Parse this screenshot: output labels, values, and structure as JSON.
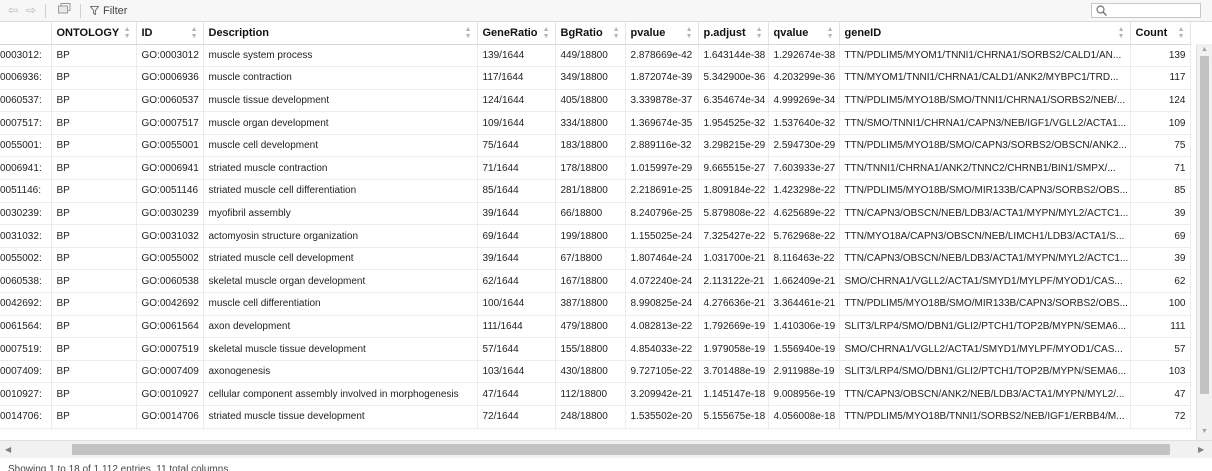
{
  "toolbar": {
    "filter_label": "Filter",
    "search_placeholder": ""
  },
  "columns": [
    "",
    "ONTOLOGY",
    "ID",
    "Description",
    "GeneRatio",
    "BgRatio",
    "pvalue",
    "p.adjust",
    "qvalue",
    "geneID",
    "Count"
  ],
  "rows": [
    [
      ":0003012",
      "BP",
      "GO:0003012",
      "muscle system process",
      "139/1644",
      "449/18800",
      "2.878669e-42",
      "1.643144e-38",
      "1.292674e-38",
      "TTN/PDLIM5/MYOM1/TNNI1/CHRNA1/SORBS2/CALD1/AN...",
      "139"
    ],
    [
      ":0006936",
      "BP",
      "GO:0006936",
      "muscle contraction",
      "117/1644",
      "349/18800",
      "1.872074e-39",
      "5.342900e-36",
      "4.203299e-36",
      "TTN/MYOM1/TNNI1/CHRNA1/CALD1/ANK2/MYBPC1/TRD...",
      "117"
    ],
    [
      ":0060537",
      "BP",
      "GO:0060537",
      "muscle tissue development",
      "124/1644",
      "405/18800",
      "3.339878e-37",
      "6.354674e-34",
      "4.999269e-34",
      "TTN/PDLIM5/MYO18B/SMO/TNNI1/CHRNA1/SORBS2/NEB/...",
      "124"
    ],
    [
      ":0007517",
      "BP",
      "GO:0007517",
      "muscle organ development",
      "109/1644",
      "334/18800",
      "1.369674e-35",
      "1.954525e-32",
      "1.537640e-32",
      "TTN/SMO/TNNI1/CHRNA1/CAPN3/NEB/IGF1/VGLL2/ACTA1...",
      "109"
    ],
    [
      ":0055001",
      "BP",
      "GO:0055001",
      "muscle cell development",
      "75/1644",
      "183/18800",
      "2.889116e-32",
      "3.298215e-29",
      "2.594730e-29",
      "TTN/PDLIM5/MYO18B/SMO/CAPN3/SORBS2/OBSCN/ANK2...",
      "75"
    ],
    [
      ":0006941",
      "BP",
      "GO:0006941",
      "striated muscle contraction",
      "71/1644",
      "178/18800",
      "1.015997e-29",
      "9.665515e-27",
      "7.603933e-27",
      "TTN/TNNI1/CHRNA1/ANK2/TNNC2/CHRNB1/BIN1/SMPX/...",
      "71"
    ],
    [
      ":0051146",
      "BP",
      "GO:0051146",
      "striated muscle cell differentiation",
      "85/1644",
      "281/18800",
      "2.218691e-25",
      "1.809184e-22",
      "1.423298e-22",
      "TTN/PDLIM5/MYO18B/SMO/MIR133B/CAPN3/SORBS2/OBS...",
      "85"
    ],
    [
      ":0030239",
      "BP",
      "GO:0030239",
      "myofibril assembly",
      "39/1644",
      "66/18800",
      "8.240796e-25",
      "5.879808e-22",
      "4.625689e-22",
      "TTN/CAPN3/OBSCN/NEB/LDB3/ACTA1/MYPN/MYL2/ACTC1...",
      "39"
    ],
    [
      ":0031032",
      "BP",
      "GO:0031032",
      "actomyosin structure organization",
      "69/1644",
      "199/18800",
      "1.155025e-24",
      "7.325427e-22",
      "5.762968e-22",
      "TTN/MYO18A/CAPN3/OBSCN/NEB/LIMCH1/LDB3/ACTA1/S...",
      "69"
    ],
    [
      ":0055002",
      "BP",
      "GO:0055002",
      "striated muscle cell development",
      "39/1644",
      "67/18800",
      "1.807464e-24",
      "1.031700e-21",
      "8.116463e-22",
      "TTN/CAPN3/OBSCN/NEB/LDB3/ACTA1/MYPN/MYL2/ACTC1...",
      "39"
    ],
    [
      ":0060538",
      "BP",
      "GO:0060538",
      "skeletal muscle organ development",
      "62/1644",
      "167/18800",
      "4.072240e-24",
      "2.113122e-21",
      "1.662409e-21",
      "SMO/CHRNA1/VGLL2/ACTA1/SMYD1/MYLPF/MYOD1/CAS...",
      "62"
    ],
    [
      ":0042692",
      "BP",
      "GO:0042692",
      "muscle cell differentiation",
      "100/1644",
      "387/18800",
      "8.990825e-24",
      "4.276636e-21",
      "3.364461e-21",
      "TTN/PDLIM5/MYO18B/SMO/MIR133B/CAPN3/SORBS2/OBS...",
      "100"
    ],
    [
      ":0061564",
      "BP",
      "GO:0061564",
      "axon development",
      "111/1644",
      "479/18800",
      "4.082813e-22",
      "1.792669e-19",
      "1.410306e-19",
      "SLIT3/LRP4/SMO/DBN1/GLI2/PTCH1/TOP2B/MYPN/SEMA6...",
      "111"
    ],
    [
      ":0007519",
      "BP",
      "GO:0007519",
      "skeletal muscle tissue development",
      "57/1644",
      "155/18800",
      "4.854033e-22",
      "1.979058e-19",
      "1.556940e-19",
      "SMO/CHRNA1/VGLL2/ACTA1/SMYD1/MYLPF/MYOD1/CAS...",
      "57"
    ],
    [
      ":0007409",
      "BP",
      "GO:0007409",
      "axonogenesis",
      "103/1644",
      "430/18800",
      "9.727105e-22",
      "3.701488e-19",
      "2.911988e-19",
      "SLIT3/LRP4/SMO/DBN1/GLI2/PTCH1/TOP2B/MYPN/SEMA6...",
      "103"
    ],
    [
      ":0010927",
      "BP",
      "GO:0010927",
      "cellular component assembly involved in morphogenesis",
      "47/1644",
      "112/18800",
      "3.209942e-21",
      "1.145147e-18",
      "9.008956e-19",
      "TTN/CAPN3/OBSCN/ANK2/NEB/LDB3/ACTA1/MYPN/MYL2/...",
      "47"
    ],
    [
      ":0014706",
      "BP",
      "GO:0014706",
      "striated muscle tissue development",
      "72/1644",
      "248/18800",
      "1.535502e-20",
      "5.155675e-18",
      "4.056008e-18",
      "TTN/PDLIM5/MYO18B/TNNI1/SORBS2/NEB/IGF1/ERBB4/M...",
      "72"
    ]
  ],
  "footer": {
    "info": "Showing 1 to 18 of 1,112 entries, 11 total columns"
  }
}
